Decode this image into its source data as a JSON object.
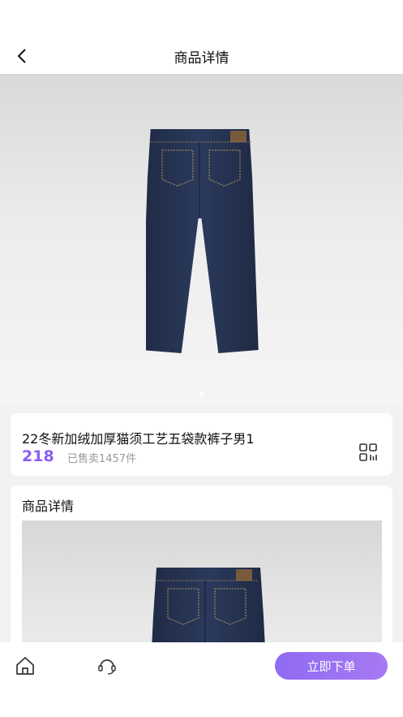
{
  "header": {
    "title": "商品详情",
    "back_icon": "chevron-left-icon"
  },
  "gallery": {
    "image": "dark-blue-jeans-back-view",
    "dots": 1,
    "active_dot": 0
  },
  "product": {
    "title": "22冬新加绒加厚猫须工艺五袋款裤子男1",
    "price": "218",
    "sold": "已售卖1457件",
    "grid_icon": "qr-code-icon"
  },
  "detail": {
    "title": "商品详情",
    "image": "dark-blue-jeans-back-view"
  },
  "bottom": {
    "home_icon": "home-icon",
    "service_icon": "headset-icon",
    "order_label": "立即下单"
  },
  "colors": {
    "accent": "#8a5cf6",
    "button_gradient_start": "#8e6bf2",
    "button_gradient_end": "#a779f3"
  }
}
